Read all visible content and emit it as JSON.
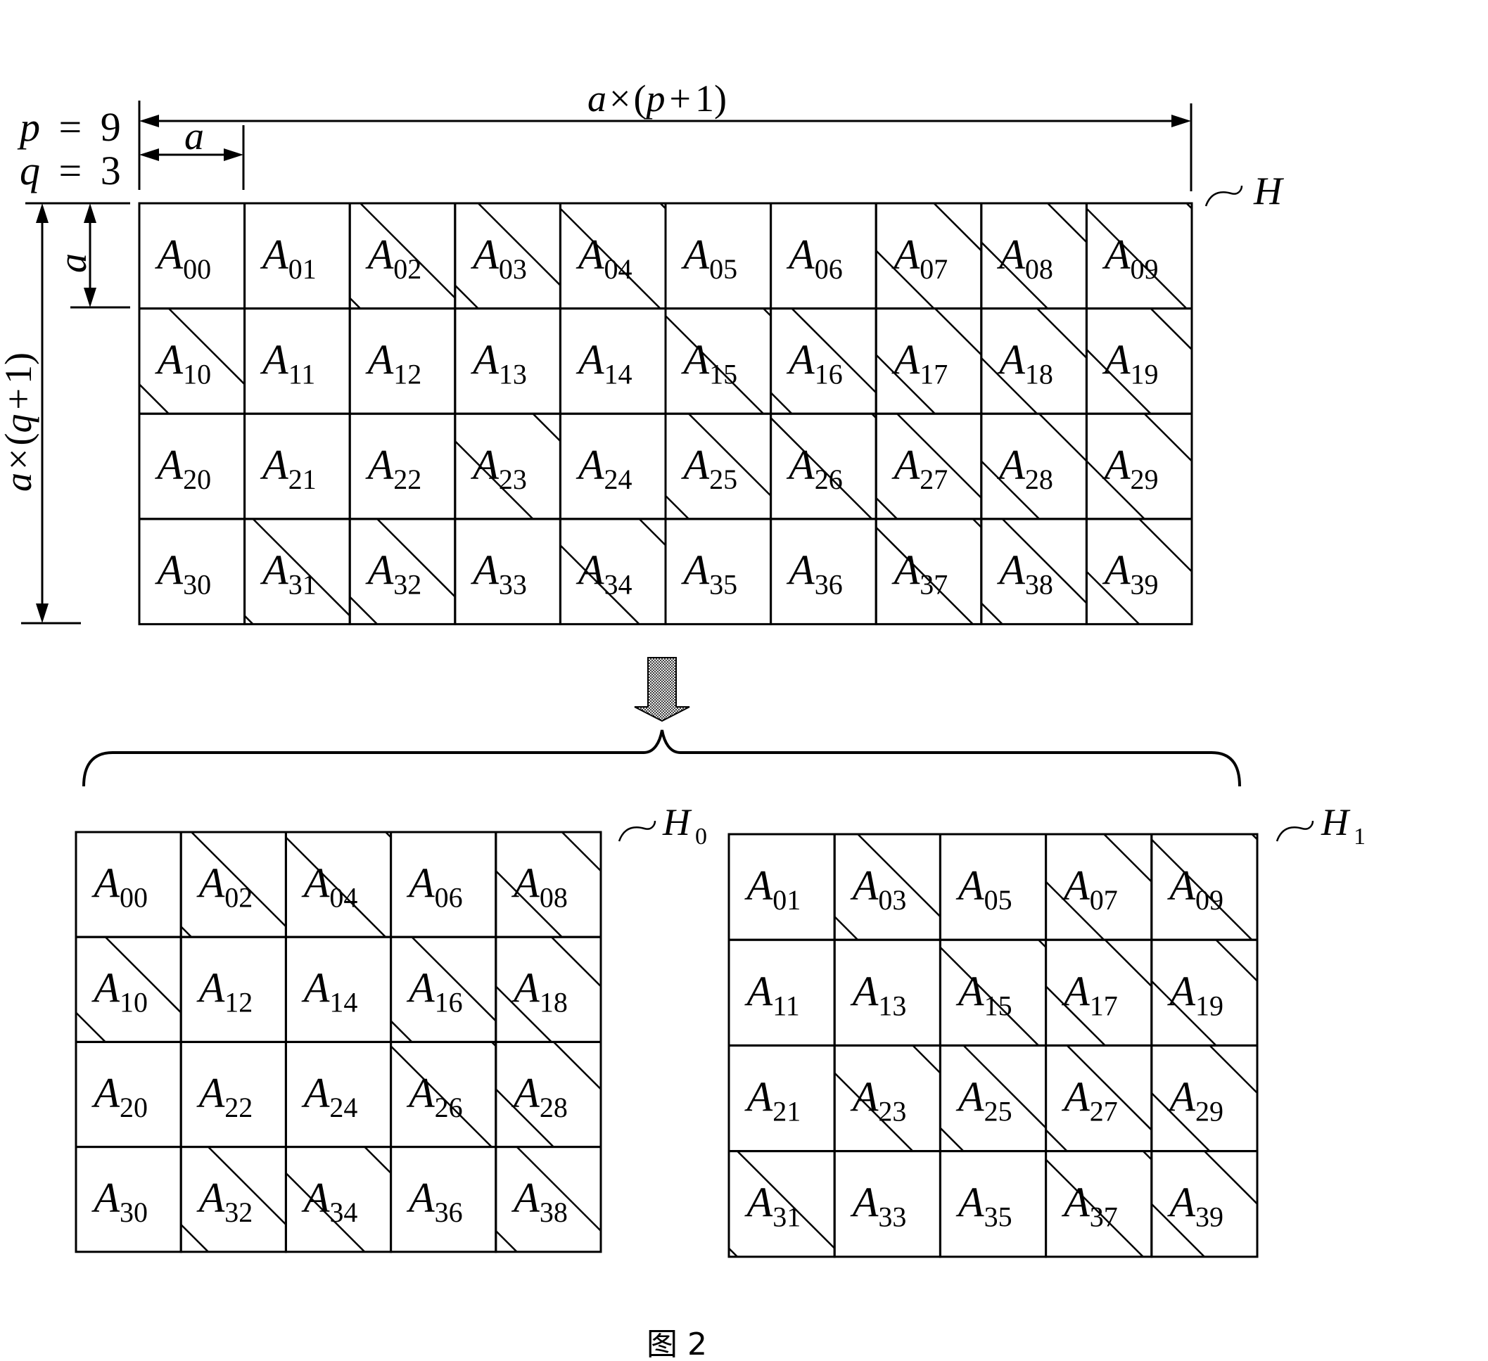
{
  "figure": {
    "caption": "图 2",
    "params": {
      "p_label": "p",
      "p_value": "9",
      "q_label": "q",
      "q_value": "3"
    },
    "dimensions": {
      "block_size_label": "a",
      "width_label": {
        "var": "a",
        "times": "×",
        "open": "(",
        "sym": "p",
        "plus": "+",
        "one": "1",
        "close": ")"
      },
      "height_label": {
        "var": "a",
        "times": "×",
        "open": "(",
        "sym": "q",
        "plus": "+",
        "one": "1",
        "close": ")"
      }
    },
    "block_symbol": "A",
    "transform_arrow": "down-arrow-icon",
    "matrices": [
      {
        "id": "H",
        "name": "H",
        "subscript": "",
        "rows": 4,
        "columns": [
          0,
          1,
          2,
          3,
          4,
          5,
          6,
          7,
          8,
          9
        ]
      },
      {
        "id": "H0",
        "name": "H",
        "subscript": "0",
        "rows": 4,
        "columns": [
          0,
          2,
          4,
          6,
          8
        ]
      },
      {
        "id": "H1",
        "name": "H",
        "subscript": "1",
        "rows": 4,
        "columns": [
          1,
          3,
          5,
          7,
          9
        ]
      }
    ],
    "block_shift_fraction_note": "fraction of block width where the cyclic diagonal meets the top edge; null = no diagonal shown",
    "block_shifts": [
      [
        null,
        null,
        0.1,
        0.22,
        0.95,
        null,
        null,
        0.55,
        0.63,
        0.95
      ],
      [
        0.28,
        null,
        null,
        null,
        null,
        0.93,
        0.2,
        0.56,
        0.53,
        0.61
      ],
      [
        null,
        null,
        null,
        0.74,
        null,
        0.22,
        0.96,
        0.2,
        0.55,
        0.55
      ],
      [
        null,
        0.08,
        0.26,
        null,
        0.75,
        null,
        null,
        0.92,
        0.2,
        0.5
      ]
    ]
  }
}
